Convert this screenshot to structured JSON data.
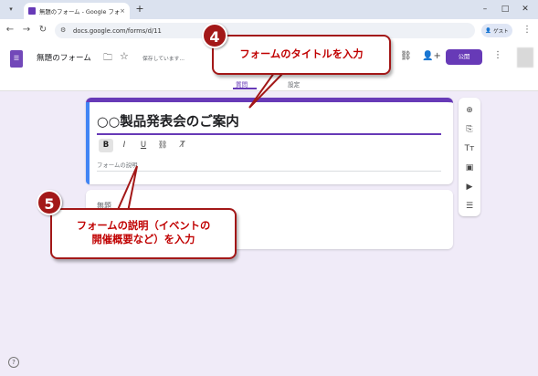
{
  "browser": {
    "tab_title": "無題のフォーム - Google フォーム",
    "tab_close": "×",
    "new_tab": "+",
    "url": "docs.google.com/forms/d/11",
    "guest_label": "ゲスト"
  },
  "header": {
    "form_name": "無題のフォーム",
    "saving_status": "保存しています...",
    "publish_label": "公開",
    "tabs": [
      {
        "label": "質問"
      },
      {
        "label": "設定"
      }
    ]
  },
  "form": {
    "title": "○○製品発表会のご案内",
    "description_placeholder": "フォームの説明",
    "format_buttons": [
      {
        "label": "B"
      },
      {
        "label": "I"
      },
      {
        "label": "U"
      }
    ],
    "question_placeholder": "無題"
  },
  "callouts": {
    "step4": {
      "number": "4",
      "text": "フォームのタイトルを入力"
    },
    "step5": {
      "number": "5",
      "line1": "フォームの説明（イベントの",
      "line2": "開催概要など）を入力"
    }
  },
  "colors": {
    "accent": "#673ab7",
    "callout": "#a31818",
    "canvas": "#f0ebf8"
  },
  "icons": [
    "forms-icon",
    "folder-icon",
    "star-icon",
    "link-icon",
    "add-person-icon",
    "add-question-icon",
    "import-icon",
    "title-icon",
    "image-icon",
    "video-icon",
    "section-icon",
    "help-icon"
  ]
}
